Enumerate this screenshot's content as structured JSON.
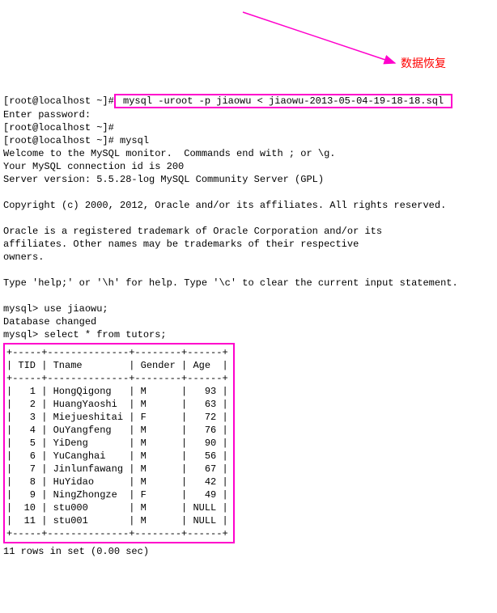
{
  "annotation": {
    "label": "数据恢复"
  },
  "prompt1_prefix": "[root@localhost ~]#",
  "cmd1": " mysql -uroot -p jiaowu < jiaowu-2013-05-04-19-18-18.sql ",
  "lines": [
    "Enter password:",
    "[root@localhost ~]#",
    "[root@localhost ~]# mysql",
    "Welcome to the MySQL monitor.  Commands end with ; or \\g.",
    "Your MySQL connection id is 200",
    "Server version: 5.5.28-log MySQL Community Server (GPL)",
    "",
    "Copyright (c) 2000, 2012, Oracle and/or its affiliates. All rights reserved.",
    "",
    "Oracle is a registered trademark of Oracle Corporation and/or its",
    "affiliates. Other names may be trademarks of their respective",
    "owners.",
    "",
    "Type 'help;' or '\\h' for help. Type '\\c' to clear the current input statement.",
    "",
    "mysql> use jiaowu;",
    "Database changed",
    "mysql> select * from tutors;"
  ],
  "chart_data": {
    "type": "table",
    "columns": [
      "TID",
      "Tname",
      "Gender",
      "Age"
    ],
    "rows": [
      {
        "TID": 1,
        "Tname": "HongQigong",
        "Gender": "M",
        "Age": 93
      },
      {
        "TID": 2,
        "Tname": "HuangYaoshi",
        "Gender": "M",
        "Age": 63
      },
      {
        "TID": 3,
        "Tname": "Miejueshitai",
        "Gender": "F",
        "Age": 72
      },
      {
        "TID": 4,
        "Tname": "OuYangfeng",
        "Gender": "M",
        "Age": 76
      },
      {
        "TID": 5,
        "Tname": "YiDeng",
        "Gender": "M",
        "Age": 90
      },
      {
        "TID": 6,
        "Tname": "YuCanghai",
        "Gender": "M",
        "Age": 56
      },
      {
        "TID": 7,
        "Tname": "Jinlunfawang",
        "Gender": "M",
        "Age": 67
      },
      {
        "TID": 8,
        "Tname": "HuYidao",
        "Gender": "M",
        "Age": 42
      },
      {
        "TID": 9,
        "Tname": "NingZhongze",
        "Gender": "F",
        "Age": 49
      },
      {
        "TID": 10,
        "Tname": "stu000",
        "Gender": "M",
        "Age": null
      },
      {
        "TID": 11,
        "Tname": "stu001",
        "Gender": "M",
        "Age": null
      }
    ]
  },
  "table": {
    "border": "+-----+--------------+--------+------+",
    "header": "| TID | Tname        | Gender | Age  |",
    "rows": [
      "|   1 | HongQigong   | M      |   93 |",
      "|   2 | HuangYaoshi  | M      |   63 |",
      "|   3 | Miejueshitai | F      |   72 |",
      "|   4 | OuYangfeng   | M      |   76 |",
      "|   5 | YiDeng       | M      |   90 |",
      "|   6 | YuCanghai    | M      |   56 |",
      "|   7 | Jinlunfawang | M      |   67 |",
      "|   8 | HuYidao      | M      |   42 |",
      "|   9 | NingZhongze  | F      |   49 |",
      "|  10 | stu000       | M      | NULL |",
      "|  11 | stu001       | M      | NULL |"
    ]
  },
  "footer": "11 rows in set (0.00 sec)"
}
